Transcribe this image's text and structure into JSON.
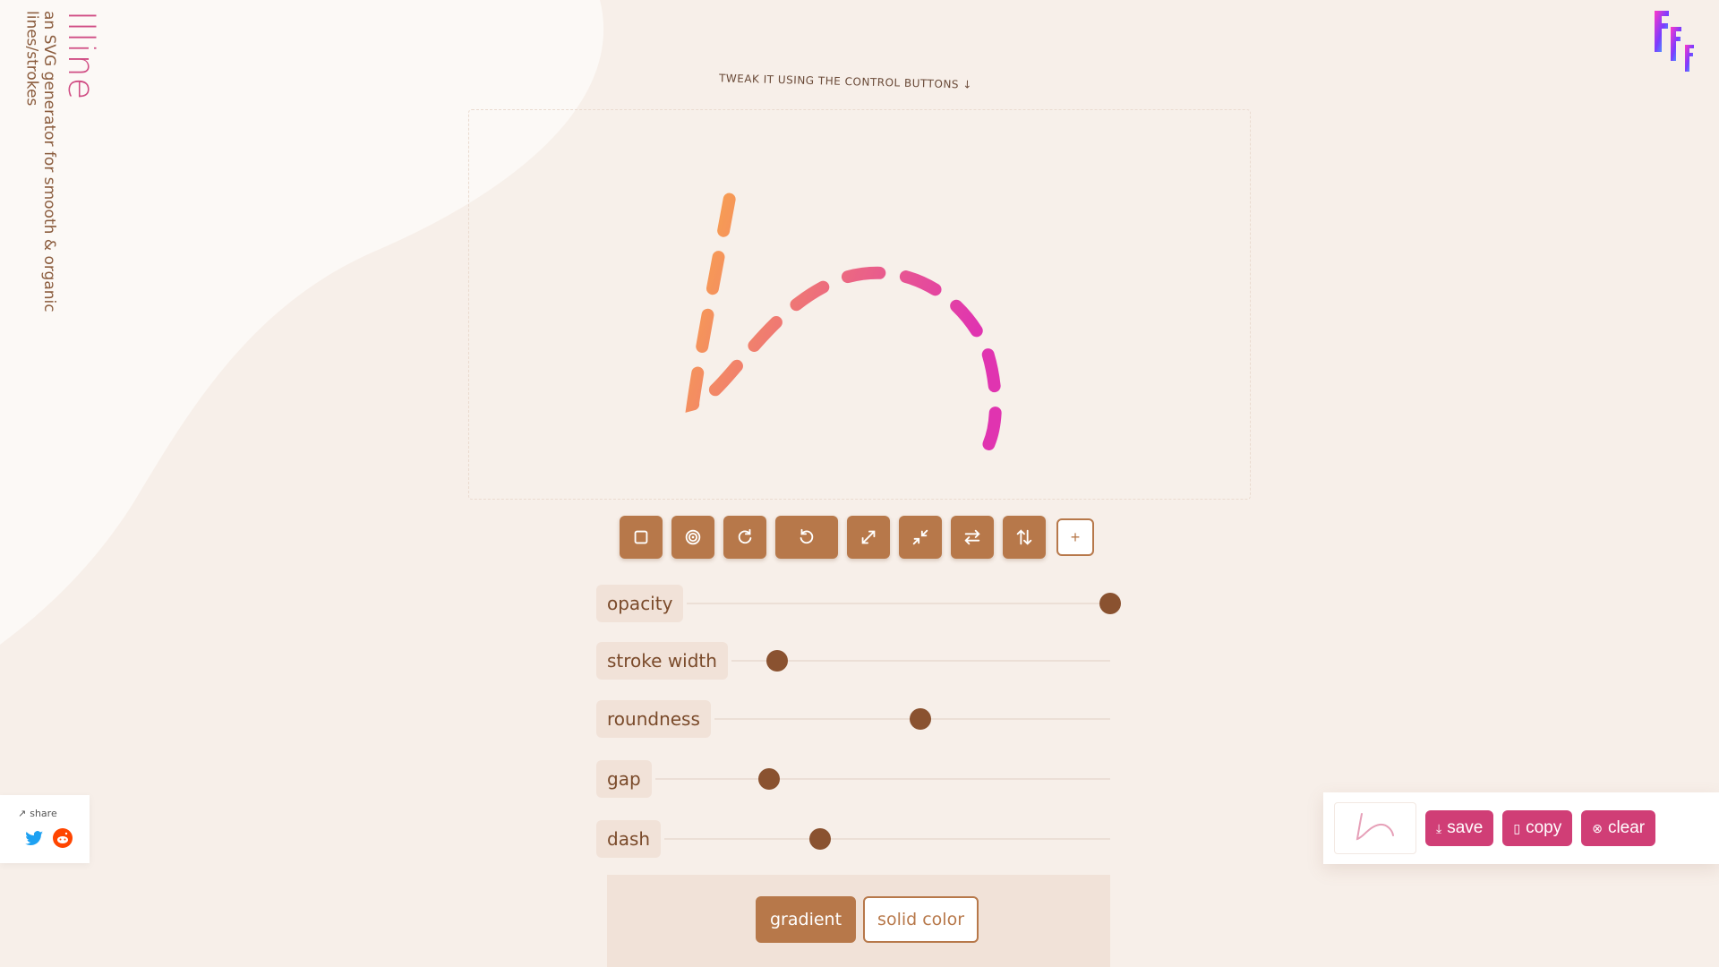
{
  "app": {
    "title": "llline",
    "tagline": "an SVG generator for smooth & organic lines/strokes"
  },
  "hint": "tweak it using the control buttons ↓",
  "toolbar": {
    "buttons": [
      {
        "name": "square-icon"
      },
      {
        "name": "target-icon"
      },
      {
        "name": "rotate-clockwise-icon"
      },
      {
        "name": "rotate-counterclockwise-icon"
      },
      {
        "name": "expand-icon"
      },
      {
        "name": "shrink-icon"
      },
      {
        "name": "swap-horizontal-icon"
      },
      {
        "name": "swap-vertical-icon"
      },
      {
        "name": "plus-icon"
      }
    ],
    "add_label": "+"
  },
  "sliders": [
    {
      "label": "opacity",
      "value": 1.0
    },
    {
      "label": "stroke width",
      "value": 0.12
    },
    {
      "label": "roundness",
      "value": 0.52
    },
    {
      "label": "gap",
      "value": 0.25
    },
    {
      "label": "dash",
      "value": 0.35
    }
  ],
  "color_mode": {
    "gradient_label": "gradient",
    "solid_label": "solid color",
    "selected": "gradient"
  },
  "share": {
    "label": "share",
    "icons": [
      "twitter-icon",
      "reddit-icon"
    ]
  },
  "actions": {
    "save_label": "save",
    "copy_label": "copy",
    "clear_label": "clear"
  },
  "colors": {
    "accent": "#b7784a",
    "accent_dark": "#8a5230",
    "pink": "#d03e76",
    "title_pink": "#d04d84",
    "gradient_start": "#f9a64b",
    "gradient_end": "#e034b0"
  }
}
